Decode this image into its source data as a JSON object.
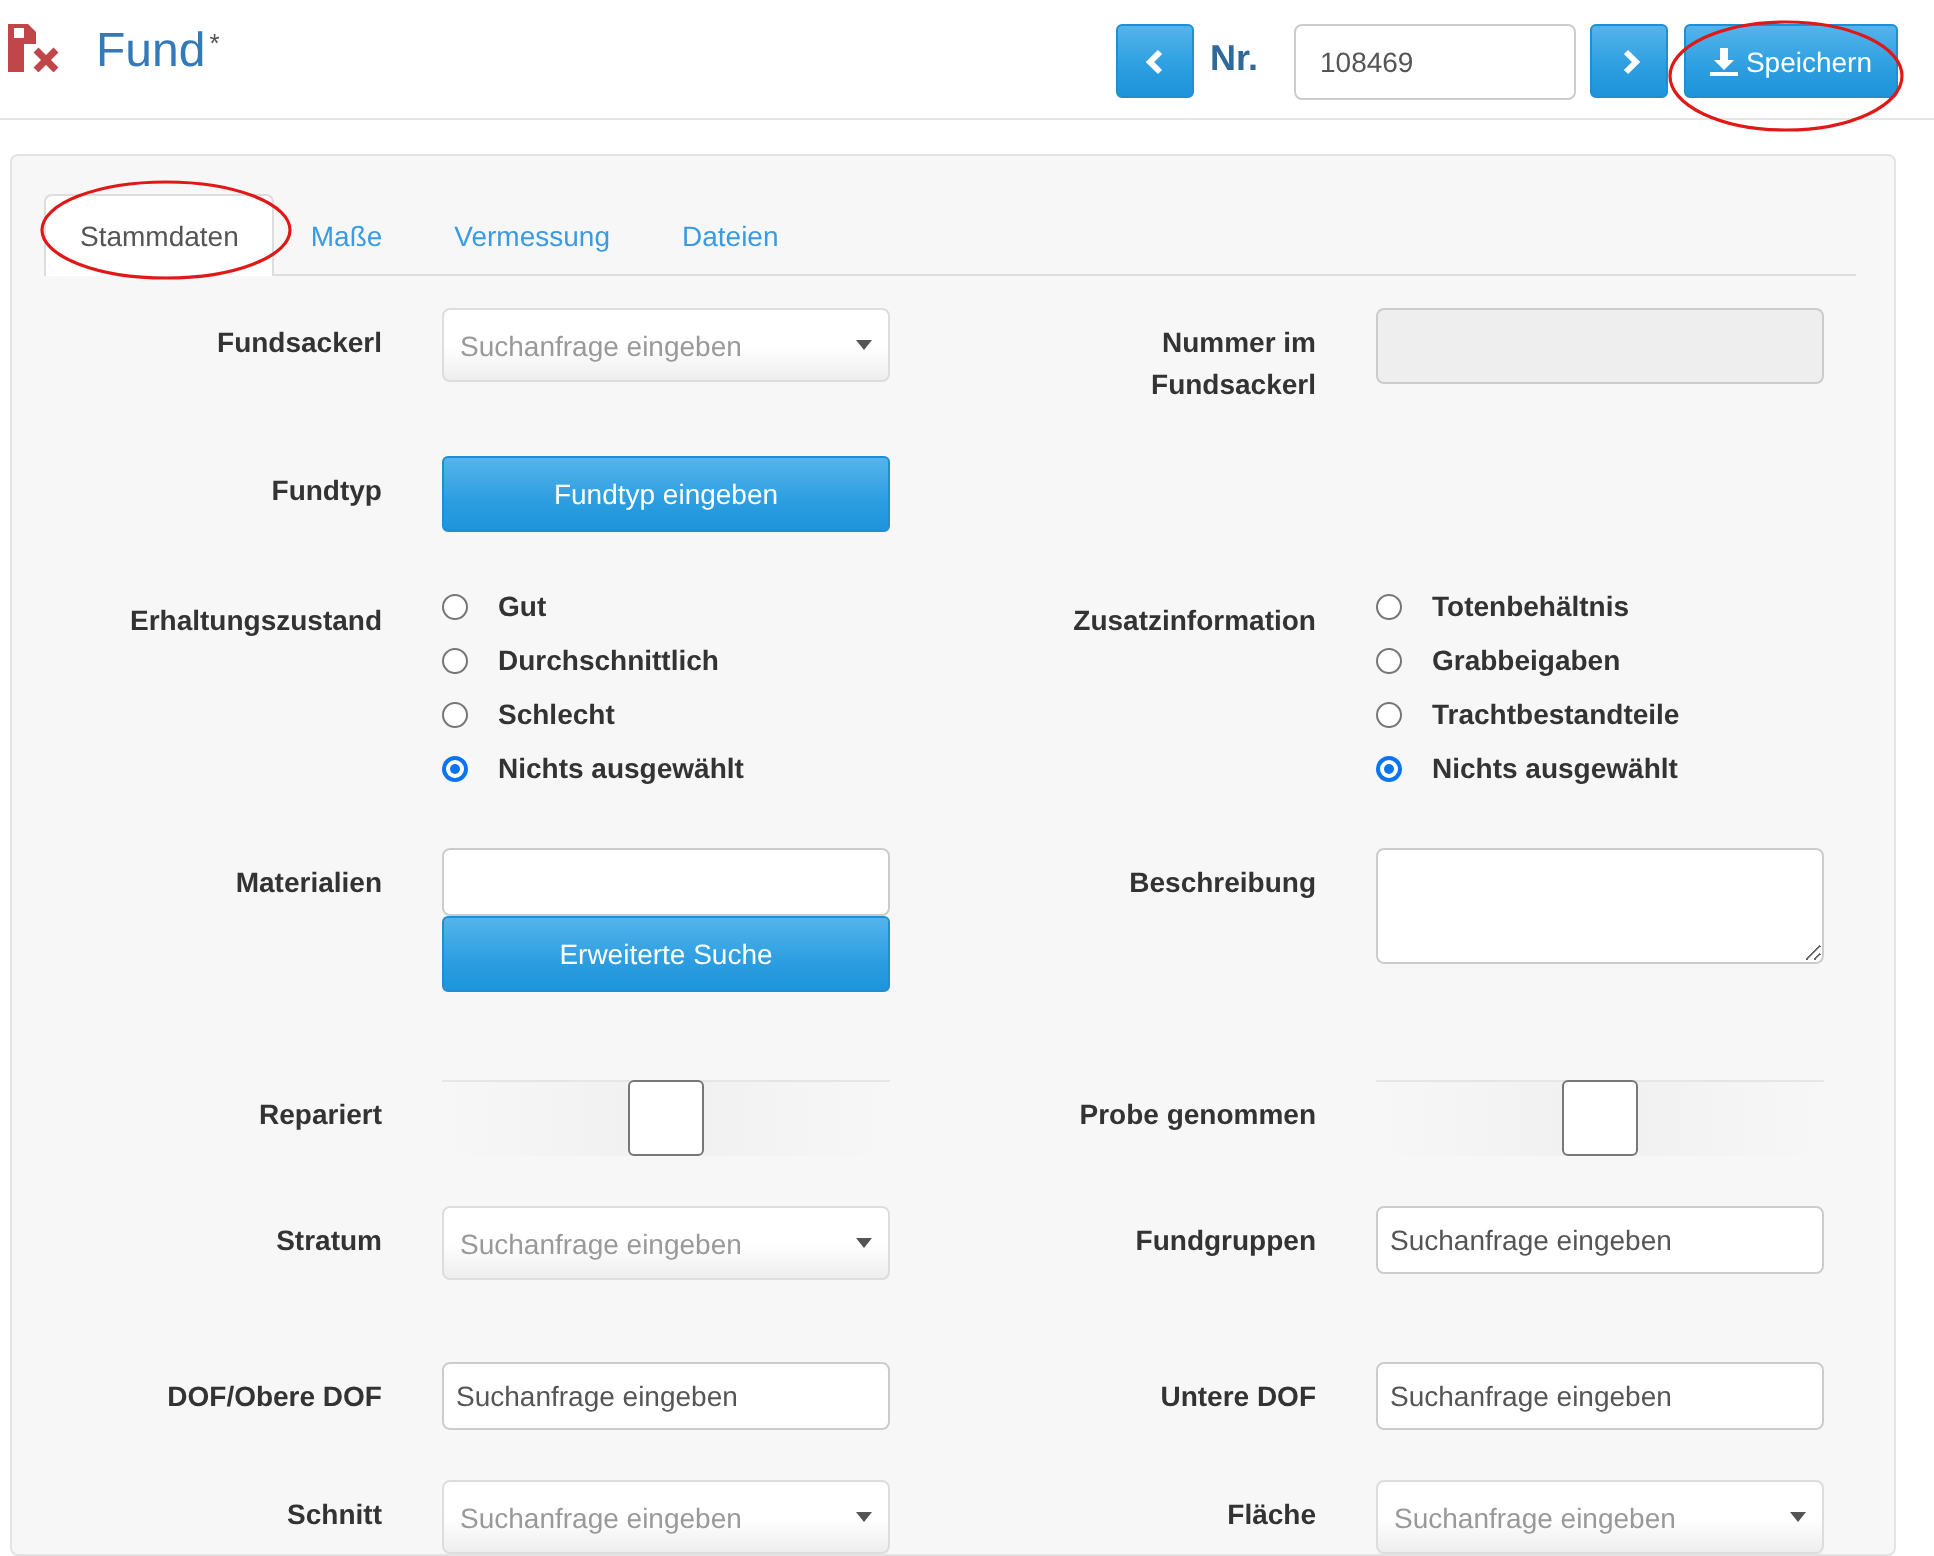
{
  "header": {
    "title": "Fund",
    "title_mark": "*",
    "number_label": "Nr.",
    "number_value": "108469",
    "save_button": {
      "label": "Speichern",
      "highlighted": true
    }
  },
  "tabs": [
    {
      "label": "Stammdaten",
      "selected": true,
      "highlighted": true
    },
    {
      "label": "Maße",
      "selected": false,
      "highlighted": false
    },
    {
      "label": "Vermessung",
      "selected": false,
      "highlighted": false
    },
    {
      "label": "Dateien",
      "selected": false,
      "highlighted": false
    }
  ],
  "rows": [
    {
      "left": {
        "label": "Fundsackerl",
        "kind": "select",
        "placeholder": "Suchanfrage eingeben"
      },
      "right": {
        "label": "Nummer im Fundsackerl",
        "kind": "disabled_input"
      }
    },
    {
      "left": {
        "label": "Fundtyp",
        "kind": "button",
        "text": "Fundtyp eingeben"
      }
    },
    {
      "left": {
        "label": "Erhaltungszustand",
        "kind": "radios",
        "options": [
          {
            "label": "Gut",
            "selected": false
          },
          {
            "label": "Durchschnittlich",
            "selected": false
          },
          {
            "label": "Schlecht",
            "selected": false
          },
          {
            "label": "Nichts ausgewählt",
            "selected": true
          }
        ]
      },
      "right": {
        "label": "Zusatzinformation",
        "kind": "radios",
        "options": [
          {
            "label": "Totenbehältnis",
            "selected": false
          },
          {
            "label": "Grabbeigaben",
            "selected": false
          },
          {
            "label": "Trachtbestandteile",
            "selected": false
          },
          {
            "label": "Nichts ausgewählt",
            "selected": true
          }
        ]
      }
    },
    {
      "left": {
        "label": "Materialien",
        "kind": "input_with_button",
        "text": "Erweiterte Suche"
      },
      "right": {
        "label": "Beschreibung",
        "kind": "textarea"
      }
    },
    {
      "left": {
        "label": "Repariert",
        "kind": "checkbox",
        "checked": false
      },
      "right": {
        "label": "Probe genommen",
        "kind": "checkbox",
        "checked": false
      }
    },
    {
      "left": {
        "label": "Stratum",
        "kind": "select",
        "placeholder": "Suchanfrage eingeben"
      },
      "right": {
        "label": "Fundgruppen",
        "kind": "input",
        "placeholder": "Suchanfrage eingeben"
      }
    },
    {
      "left": {
        "label": "DOF/Obere DOF",
        "kind": "input",
        "placeholder": "Suchanfrage eingeben"
      },
      "right": {
        "label": "Untere DOF",
        "kind": "input",
        "placeholder": "Suchanfrage eingeben"
      }
    },
    {
      "left": {
        "label": "Schnitt",
        "kind": "select",
        "placeholder": "Suchanfrage eingeben"
      },
      "right": {
        "label": "Fläche",
        "kind": "select",
        "placeholder": "Suchanfrage eingeben"
      }
    }
  ]
}
